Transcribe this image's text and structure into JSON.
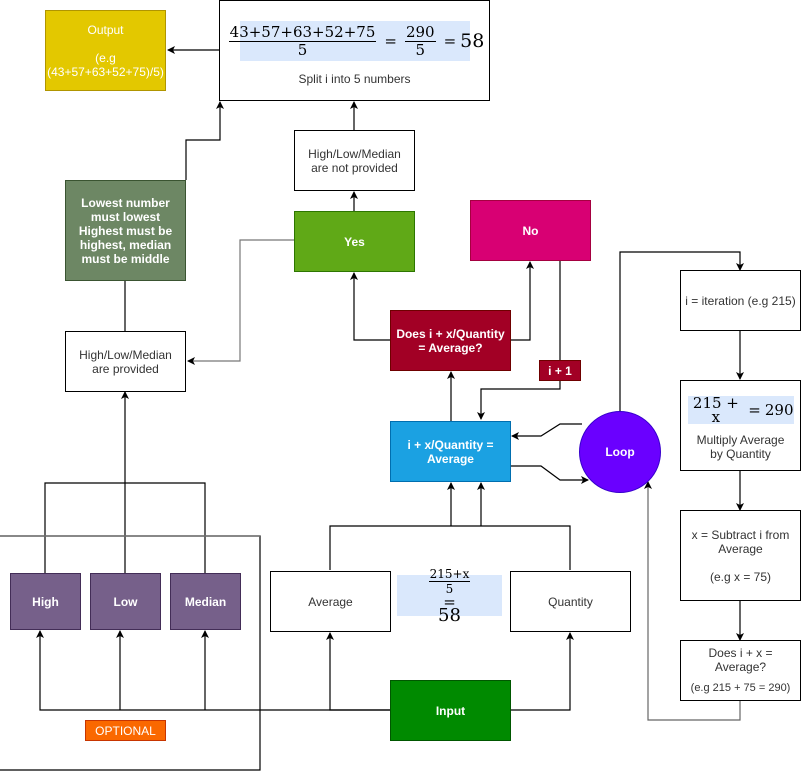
{
  "diagram": {
    "colors": {
      "output": "#e3c800",
      "rule": "#6d8764",
      "yes": "#60a917",
      "no": "#d80073",
      "decision": "#a20025",
      "process": "#1ba1e2",
      "loop": "#6a00ff",
      "optional_items": "#76608a",
      "optional_badge": "#fa6800",
      "input": "#008a00",
      "math_bg": "#dae8fc"
    },
    "nodes": {
      "output": {
        "title": "Output",
        "example": "(e.g (43+57+63+52+75)/5)"
      },
      "split": {
        "formula": {
          "numerator": "43+57+63+52+75",
          "denominator": "5",
          "eq": "=",
          "mid_num": "290",
          "mid_den": "5",
          "result": "58"
        },
        "label": "Split i into 5 numbers"
      },
      "not_provided": {
        "label": "High/Low/Median are not provided"
      },
      "rule": {
        "label": "Lowest number must lowest Highest must be highest, median must be middle"
      },
      "yes": {
        "label": "Yes"
      },
      "no": {
        "label": "No"
      },
      "provided": {
        "label": "High/Low/Median are provided"
      },
      "decision": {
        "label": "Does i + x/Quantity = Average?"
      },
      "increment": {
        "label": "i + 1"
      },
      "process": {
        "label": "i + x/Quantity = Average"
      },
      "loop": {
        "label": "Loop"
      },
      "iteration": {
        "label": "i = iteration (e.g 215)"
      },
      "multiply": {
        "formula": {
          "lhs": "215 + x",
          "eq": "=",
          "rhs": "290"
        },
        "label": "Multiply Average by Quantity"
      },
      "subtract": {
        "label": "x = Subtract i from Average",
        "example": "(e.g x = 75)"
      },
      "check": {
        "label": "Does i + x = Average?",
        "example": "(e.g 215 + 75 = 290)"
      },
      "high": {
        "label": "High"
      },
      "low": {
        "label": "Low"
      },
      "median": {
        "label": "Median"
      },
      "average": {
        "label": "Average"
      },
      "average_formula": {
        "numerator": "215+x",
        "denominator": "5",
        "eq": "=",
        "result": "58"
      },
      "quantity": {
        "label": "Quantity"
      },
      "input": {
        "label": "Input"
      },
      "optional": {
        "label": "OPTIONAL"
      }
    }
  }
}
